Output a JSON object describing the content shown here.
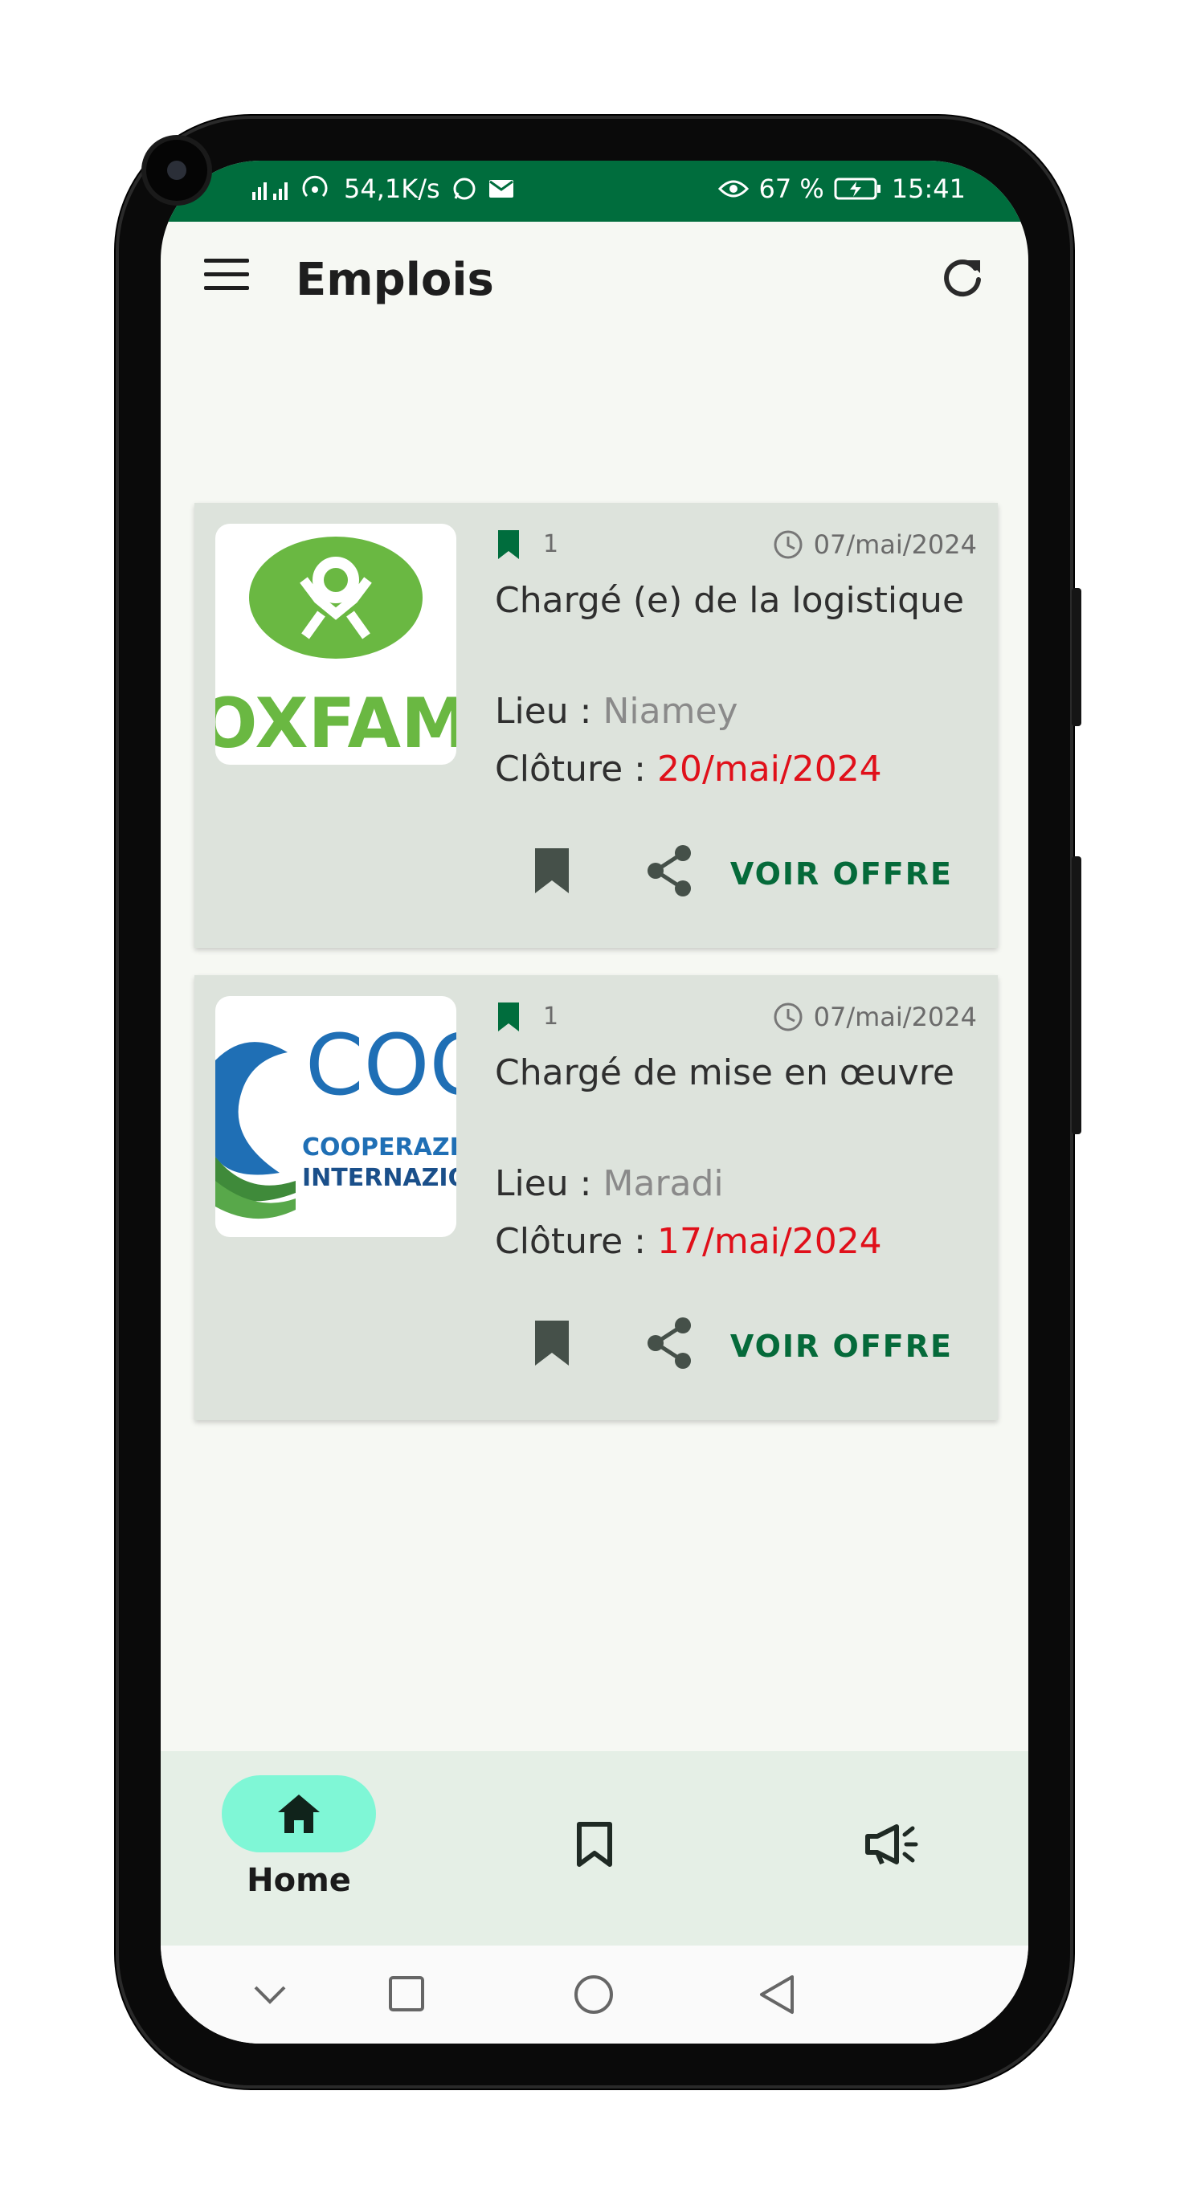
{
  "status_bar": {
    "network_speed": "54,1K/s",
    "battery": "67 %",
    "time": "15:41"
  },
  "app_bar": {
    "title": "Emplois"
  },
  "jobs": [
    {
      "logo_text": "OXFAM",
      "count": "1",
      "posted_date": "07/mai/2024",
      "title": "Chargé (e) de la logistique",
      "location_label": "Lieu :",
      "location": "Niamey",
      "deadline_label": "Clôture :",
      "deadline": "20/mai/2024",
      "action_label": "VOIR OFFRE"
    },
    {
      "logo_text": "COOPERAZIONE INTERNAZIONALE",
      "count": "1",
      "posted_date": "07/mai/2024",
      "title": "Chargé de mise en œuvre",
      "location_label": "Lieu :",
      "location": "Maradi",
      "deadline_label": "Clôture :",
      "deadline": "17/mai/2024",
      "action_label": "VOIR OFFRE"
    }
  ],
  "bottom_nav": {
    "items": [
      {
        "label": "Home",
        "icon": "home-icon",
        "selected": true
      },
      {
        "label": "",
        "icon": "bookmark-icon",
        "selected": false
      },
      {
        "label": "",
        "icon": "megaphone-icon",
        "selected": false
      }
    ]
  },
  "colors": {
    "status_bar": "#006d3d",
    "accent": "#056a3a",
    "deadline": "#e0101a",
    "card_bg": "#dde3dc",
    "nav_pill": "#7ff7d6"
  }
}
